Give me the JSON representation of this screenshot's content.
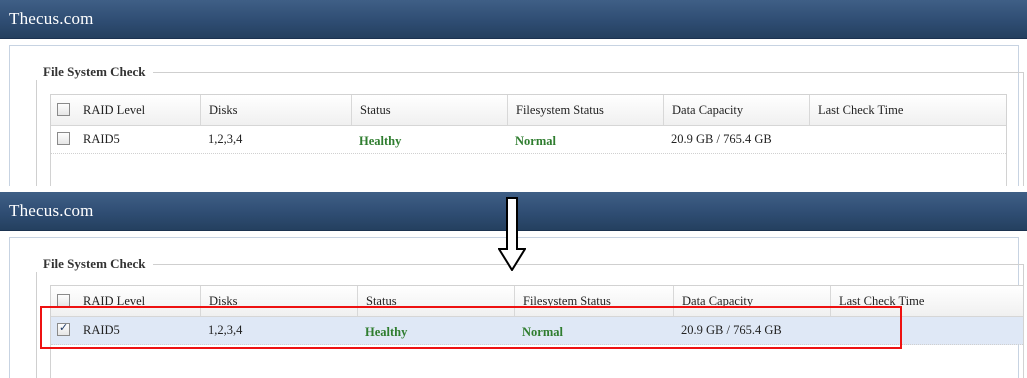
{
  "app_title": "Thecus.com",
  "section_title": "File System Check",
  "columns": [
    "RAID Level",
    "Disks",
    "Status",
    "Filesystem Status",
    "Data Capacity",
    "Last Check Time"
  ],
  "before": {
    "row": {
      "checked": false,
      "raid_level": "RAID5",
      "disks": "1,2,3,4",
      "status": "Healthy",
      "filesystem_status": "Normal",
      "data_capacity": "20.9 GB / 765.4 GB",
      "last_check_time": ""
    }
  },
  "after": {
    "row": {
      "checked": true,
      "raid_level": "RAID5",
      "disks": "1,2,3,4",
      "status": "Healthy",
      "filesystem_status": "Normal",
      "data_capacity": "20.9 GB / 765.4 GB",
      "last_check_time": ""
    }
  },
  "colors": {
    "titlebar": "#2f4d73",
    "status_good": "#2f7d2f",
    "highlight": "#e11111"
  },
  "icons": {
    "arrow": "down-arrow-icon",
    "checkbox": "checkbox-icon"
  }
}
